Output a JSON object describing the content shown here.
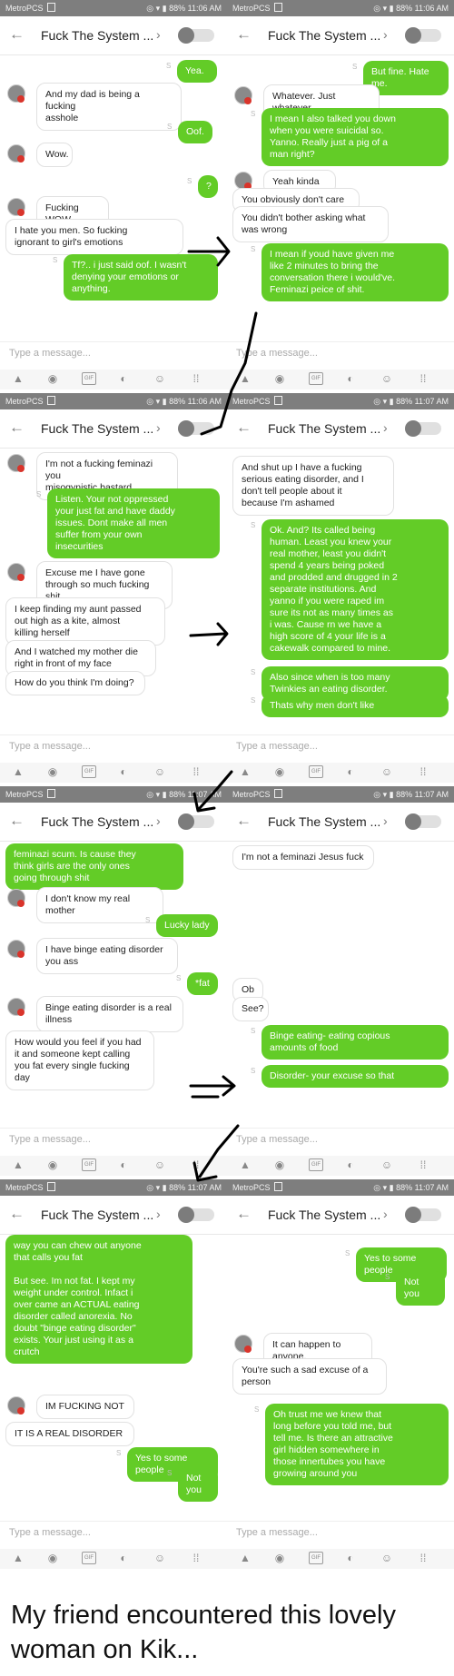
{
  "status_bar": {
    "carrier": "MetroPCS",
    "battery": "88%"
  },
  "compose_placeholder": "Type a message...",
  "gif_label": "GIF",
  "panels": [
    {
      "time": "11:06 AM",
      "title": "Fuck The System ...",
      "messages": [
        {
          "dir": "out",
          "text": "Yea."
        },
        {
          "dir": "in",
          "text": "And my dad is being a fucking\nasshole"
        },
        {
          "dir": "out",
          "text": "Oof."
        },
        {
          "dir": "in",
          "text": "Wow."
        },
        {
          "dir": "out",
          "text": "?"
        },
        {
          "dir": "in",
          "text": "Fucking WOW."
        },
        {
          "dir": "in",
          "text": "I hate you men. So fucking\nignorant to girl's emotions"
        },
        {
          "dir": "out",
          "text": "Tf?.. i just said oof. I wasn't\ndenying your emotions or\nanything."
        }
      ]
    },
    {
      "time": "11:06 AM",
      "title": "Fuck The System ...",
      "messages": [
        {
          "dir": "out",
          "text": "But fine. Hate me."
        },
        {
          "dir": "in",
          "text": "Whatever. Just whatever."
        },
        {
          "dir": "out",
          "text": "I mean I also talked you down\nwhen you were suicidal so.\nYanno. Really just a pig of a\nman right?"
        },
        {
          "dir": "in",
          "text": "Yeah kinda"
        },
        {
          "dir": "in",
          "text": "You obviously don't care"
        },
        {
          "dir": "in",
          "text": "You didn't bother asking what\nwas wrong"
        },
        {
          "dir": "out",
          "text": "I mean if youd have given me\nlike 2 minutes to bring the\nconversation there i would've.\nFeminazi peice of shit."
        }
      ]
    },
    {
      "time": "11:06 AM",
      "title": "Fuck The System ...",
      "messages": [
        {
          "dir": "in",
          "text": "I'm not a fucking feminazi you\nmisogynistic bastard"
        },
        {
          "dir": "out",
          "text": "Listen. Your not oppressed\nyour just fat and have daddy\nissues. Dont make all men\nsuffer from your own\ninsecurities"
        },
        {
          "dir": "in",
          "text": "Excuse me I have gone\nthrough so much fucking shit"
        },
        {
          "dir": "in",
          "text": "I keep finding my aunt passed\nout high as a kite, almost\nkilling herself"
        },
        {
          "dir": "in",
          "text": "And I watched my mother die\nright in front of my face"
        },
        {
          "dir": "in",
          "text": "How do you think I'm doing?"
        }
      ]
    },
    {
      "time": "11:07 AM",
      "title": "Fuck The System ...",
      "messages": [
        {
          "dir": "in",
          "text": "And shut up I have a fucking\nserious eating disorder, and I\ndon't tell people about it\nbecause I'm ashamed"
        },
        {
          "dir": "out",
          "text": "Ok. And? Its called being\nhuman. Least you knew your\nreal mother, least you didn't\nspend 4 years being poked\nand prodded and drugged in 2\nseparate institutions. And\nyanno if you were raped im\nsure its not as many times as\ni was. Cause rn we have a\nhigh score of 4 your life is a\ncakewalk compared to mine."
        },
        {
          "dir": "out",
          "text": "Also since when is too many\nTwinkies an eating disorder."
        },
        {
          "dir": "out",
          "text": "Thats why men don't like"
        }
      ]
    },
    {
      "time": "11:07 AM",
      "title": "Fuck The System ...",
      "messages": [
        {
          "dir": "out",
          "text": "feminazi scum. Is cause they\nthink girls are the only ones\ngoing through shit"
        },
        {
          "dir": "in",
          "text": "I don't know my real mother"
        },
        {
          "dir": "out",
          "text": "Lucky lady"
        },
        {
          "dir": "in",
          "text": "I have binge eating disorder\nyou ass"
        },
        {
          "dir": "out",
          "text": "*fat"
        },
        {
          "dir": "in",
          "text": "Binge eating disorder is a real\nillness"
        },
        {
          "dir": "in",
          "text": "How would you feel if you had\nit and someone kept calling\nyou fat every single fucking\nday"
        }
      ]
    },
    {
      "time": "11:07 AM",
      "title": "Fuck The System ...",
      "messages": [
        {
          "dir": "in",
          "text": "I'm not a feminazi Jesus fuck"
        },
        {
          "dir": "in",
          "text": "Ob"
        },
        {
          "dir": "in",
          "text": "See?"
        },
        {
          "dir": "out",
          "text": "Binge eating- eating copious\namounts of food"
        },
        {
          "dir": "out",
          "text": "Disorder- your excuse so that"
        }
      ]
    },
    {
      "time": "11:07 AM",
      "title": "Fuck The System ...",
      "messages": [
        {
          "dir": "out",
          "text": "way you can chew out anyone\nthat calls you fat\n\nBut see. Im not fat. I kept my\nweight under control. Infact i\nover came an ACTUAL eating\ndisorder called anorexia. No\ndoubt \"binge eating disorder\"\nexists. Your just using it as a\ncrutch"
        },
        {
          "dir": "in",
          "text": "IM FUCKING NOT"
        },
        {
          "dir": "in",
          "text": "IT IS A REAL DISORDER"
        },
        {
          "dir": "out",
          "text": "Yes to some people"
        },
        {
          "dir": "out",
          "text": "Not you"
        }
      ]
    },
    {
      "time": "11:07 AM",
      "title": "Fuck The System ...",
      "messages": [
        {
          "dir": "in",
          "text": "IM FUCKING NOT"
        },
        {
          "dir": "in",
          "text": "IT IS A REAL DISORDER"
        },
        {
          "dir": "out",
          "text": "Yes to some people"
        },
        {
          "dir": "out",
          "text": "Not you"
        },
        {
          "dir": "in",
          "text": "It can happen to anyone."
        },
        {
          "dir": "in",
          "text": "You're such a sad excuse of a\nperson"
        },
        {
          "dir": "out",
          "text": "Oh trust me we knew that\nlong before you told me, but\ntell me. Is there an attractive\ngirl hidden somewhere in\nthose innertubes you have\ngrowing around you"
        }
      ]
    }
  ],
  "caption": "My friend encountered this lovely woman on Kik..."
}
